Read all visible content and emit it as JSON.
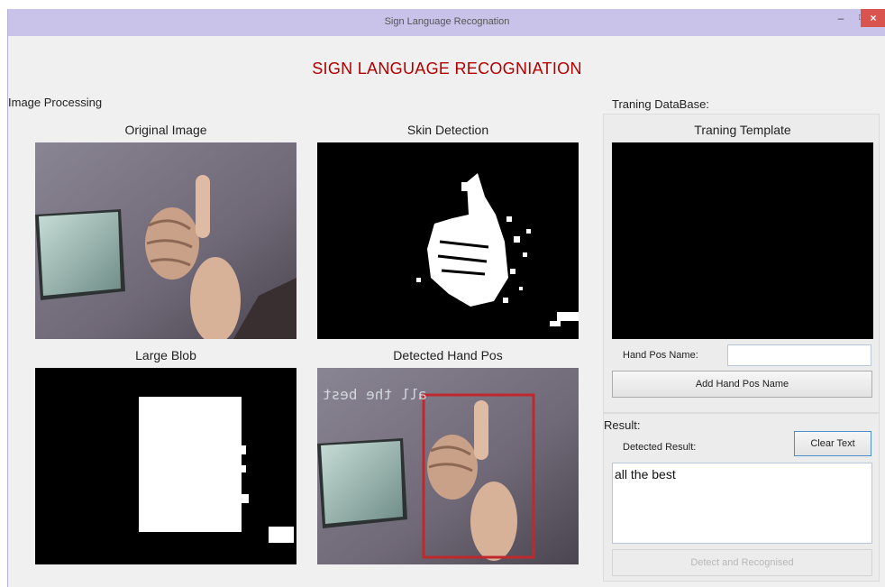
{
  "window": {
    "title": "Sign Language Recognation",
    "controls": {
      "minimize": "–",
      "maximize": "□",
      "close": "×"
    },
    "close_color": "#d9534f"
  },
  "app": {
    "title": "SIGN LANGUAGE RECOGNIATION",
    "title_color": "#b00000"
  },
  "image_processing": {
    "label": "Image Processing",
    "panels": {
      "original": "Original Image",
      "skin": "Skin Detection",
      "blob": "Large Blob",
      "detected": "Detected Hand Pos"
    },
    "overlay_text": "all the best",
    "box_color": "#c0282d"
  },
  "training": {
    "label": "Traning DataBase:",
    "template_caption": "Traning Template",
    "hand_pos_label": "Hand Pos Name:",
    "hand_pos_value": "",
    "add_button": "Add Hand Pos Name"
  },
  "result": {
    "label": "Result:",
    "detected_label": "Detected Result:",
    "clear_button": "Clear Text",
    "text": "all the best",
    "detect_button": "Detect and Recognised"
  }
}
